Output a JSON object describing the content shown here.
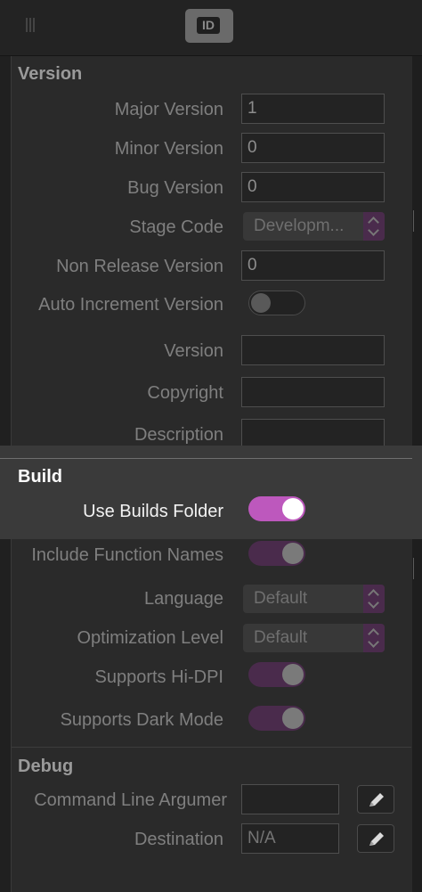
{
  "toolbar": {
    "id_button": "ID"
  },
  "version": {
    "title": "Version",
    "major": {
      "label": "Major Version",
      "value": "1"
    },
    "minor": {
      "label": "Minor Version",
      "value": "0"
    },
    "bug": {
      "label": "Bug Version",
      "value": "0"
    },
    "stage": {
      "label": "Stage Code",
      "value": "Developm..."
    },
    "non_release": {
      "label": "Non Release Version",
      "value": "0"
    },
    "auto_increment": {
      "label": "Auto Increment Version",
      "on": false
    },
    "version_text": {
      "label": "Version",
      "value": ""
    },
    "copyright": {
      "label": "Copyright",
      "value": ""
    },
    "description": {
      "label": "Description",
      "value": ""
    }
  },
  "build": {
    "title": "Build",
    "use_builds_folder": {
      "label": "Use Builds Folder",
      "on": true
    },
    "include_function_names": {
      "label": "Include Function Names",
      "on": true
    },
    "language": {
      "label": "Language",
      "value": "Default"
    },
    "optimization": {
      "label": "Optimization Level",
      "value": "Default"
    },
    "hidpi": {
      "label": "Supports Hi-DPI",
      "on": true
    },
    "dark_mode": {
      "label": "Supports Dark Mode",
      "on": true
    }
  },
  "debug": {
    "title": "Debug",
    "command_line": {
      "label": "Command Line Argumer",
      "value": ""
    },
    "destination": {
      "label": "Destination",
      "placeholder": "N/A"
    }
  },
  "colors": {
    "accent": "#bd58bd",
    "accent_dim": "#4a2b4c",
    "panel": "#2a2a2a",
    "highlight": "#3a3a3a"
  }
}
